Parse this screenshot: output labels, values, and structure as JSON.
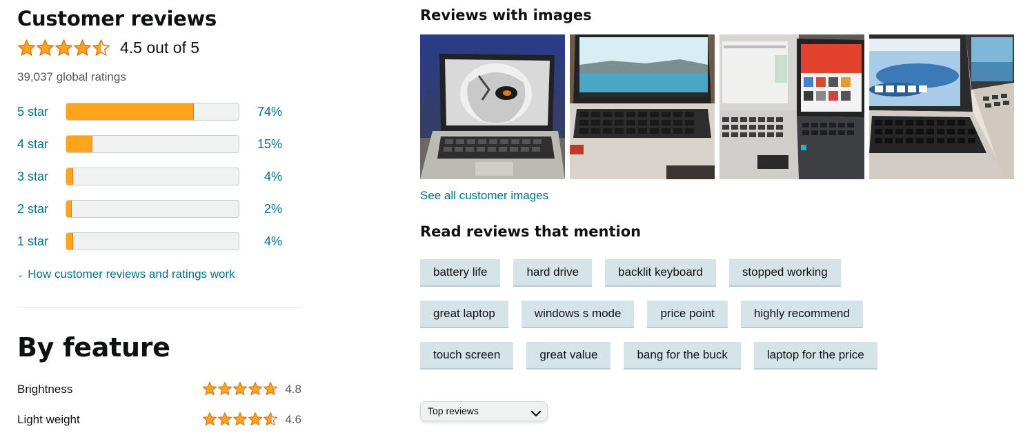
{
  "reviews": {
    "title": "Customer reviews",
    "rating_text": "4.5 out of 5",
    "rating_value": 4.5,
    "global_ratings": "39,037 global ratings",
    "histogram": [
      {
        "label": "5 star",
        "percent_text": "74%",
        "fraction": 0.74
      },
      {
        "label": "4 star",
        "percent_text": "15%",
        "fraction": 0.15
      },
      {
        "label": "3 star",
        "percent_text": "4%",
        "fraction": 0.04
      },
      {
        "label": "2 star",
        "percent_text": "2%",
        "fraction": 0.02
      },
      {
        "label": "1 star",
        "percent_text": "4%",
        "fraction": 0.04
      }
    ],
    "how_link": "How customer reviews and ratings work"
  },
  "features": {
    "title": "By feature",
    "items": [
      {
        "name": "Brightness",
        "value": "4.8",
        "rating": 4.8
      },
      {
        "name": "Light weight",
        "value": "4.6",
        "rating": 4.6
      }
    ]
  },
  "images_section": {
    "title": "Reviews with images",
    "see_all": "See all customer images",
    "thumbnails": [
      "laptop-skull-wallpaper-image",
      "laptop-lake-wallpaper-image",
      "two-laptops-image",
      "laptop-sky-wallpaper-image"
    ]
  },
  "mentions": {
    "title": "Read reviews that mention",
    "rows": [
      [
        "battery life",
        "hard drive",
        "backlit keyboard",
        "stopped working"
      ],
      [
        "great laptop",
        "windows s mode",
        "price point",
        "highly recommend"
      ],
      [
        "touch screen",
        "great value",
        "bang for the buck",
        "laptop for the price"
      ]
    ]
  },
  "sort": {
    "selected": "Top reviews"
  },
  "colors": {
    "star": "#ffa41c",
    "star_stroke": "#de7921",
    "link": "#007185",
    "chip": "#d5e4e6"
  }
}
